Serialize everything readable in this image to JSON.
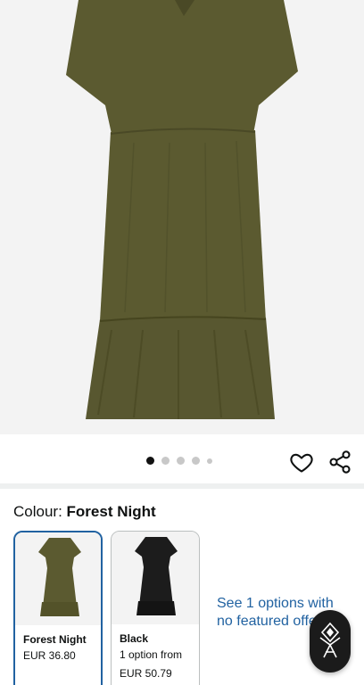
{
  "product": {
    "image_alt": "dress-front-view",
    "image_color": "#5b5a30",
    "carousel": {
      "count": 5,
      "active_index": 0
    }
  },
  "actions": {
    "wishlist_icon": "heart-icon",
    "share_icon": "share-icon"
  },
  "colour": {
    "label": "Colour: ",
    "selected_name": "Forest Night"
  },
  "variants": [
    {
      "name": "Forest Night",
      "line2": "EUR 36.80",
      "line3": "",
      "color": "#5b5a30",
      "selected": true
    },
    {
      "name": "Black",
      "line2": "1 option from",
      "line3": "EUR 50.79",
      "color": "#1c1c1c",
      "selected": false
    }
  ],
  "see_more": {
    "text": "See 1 options with no featured offers"
  },
  "floating_button": {
    "icon": "assistant-logo-icon"
  },
  "colors": {
    "link": "#2162a1",
    "selected_border": "#2162a1"
  }
}
